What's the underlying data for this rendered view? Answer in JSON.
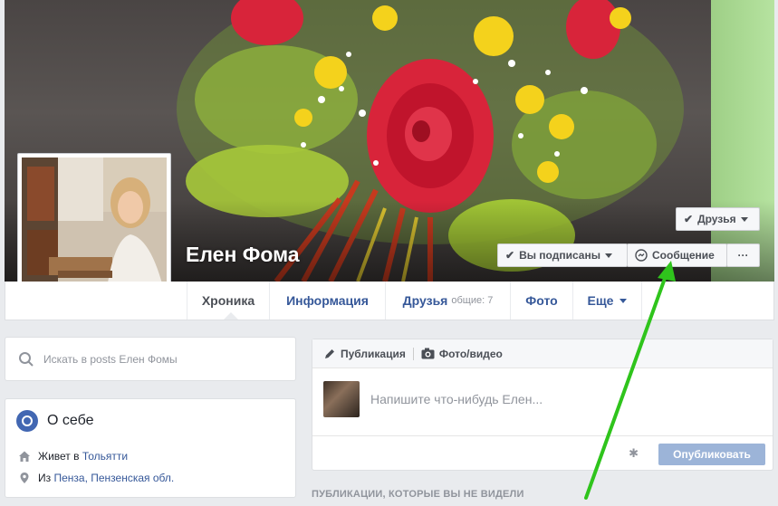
{
  "profile": {
    "name": "Елен Фома"
  },
  "cover_buttons": {
    "friends": "Друзья",
    "subscribed": "Вы подписаны",
    "message": "Сообщение",
    "more": "···"
  },
  "tabs": [
    {
      "label": "Хроника"
    },
    {
      "label": "Информация"
    },
    {
      "label": "Друзья",
      "sub": "общие: 7"
    },
    {
      "label": "Фото"
    },
    {
      "label": "Еще"
    }
  ],
  "search": {
    "placeholder": "Искать в posts Елен Фомы"
  },
  "about": {
    "title": "О себе",
    "lives_prefix": "Живет в",
    "lives_city": "Тольятти",
    "from_prefix": "Из",
    "from_place": "Пенза, Пензенская обл."
  },
  "composer": {
    "tab_post": "Публикация",
    "tab_photo": "Фото/видео",
    "placeholder": "Напишите что-нибудь Елен...",
    "publish": "Опубликовать"
  },
  "feed": {
    "unseen_header": "ПУБЛИКАЦИИ, КОТОРЫЕ ВЫ НЕ ВИДЕЛИ"
  },
  "colors": {
    "link": "#365899",
    "annotation_arrow": "#2fc41c",
    "publish_disabled": "#9cb4d8"
  }
}
